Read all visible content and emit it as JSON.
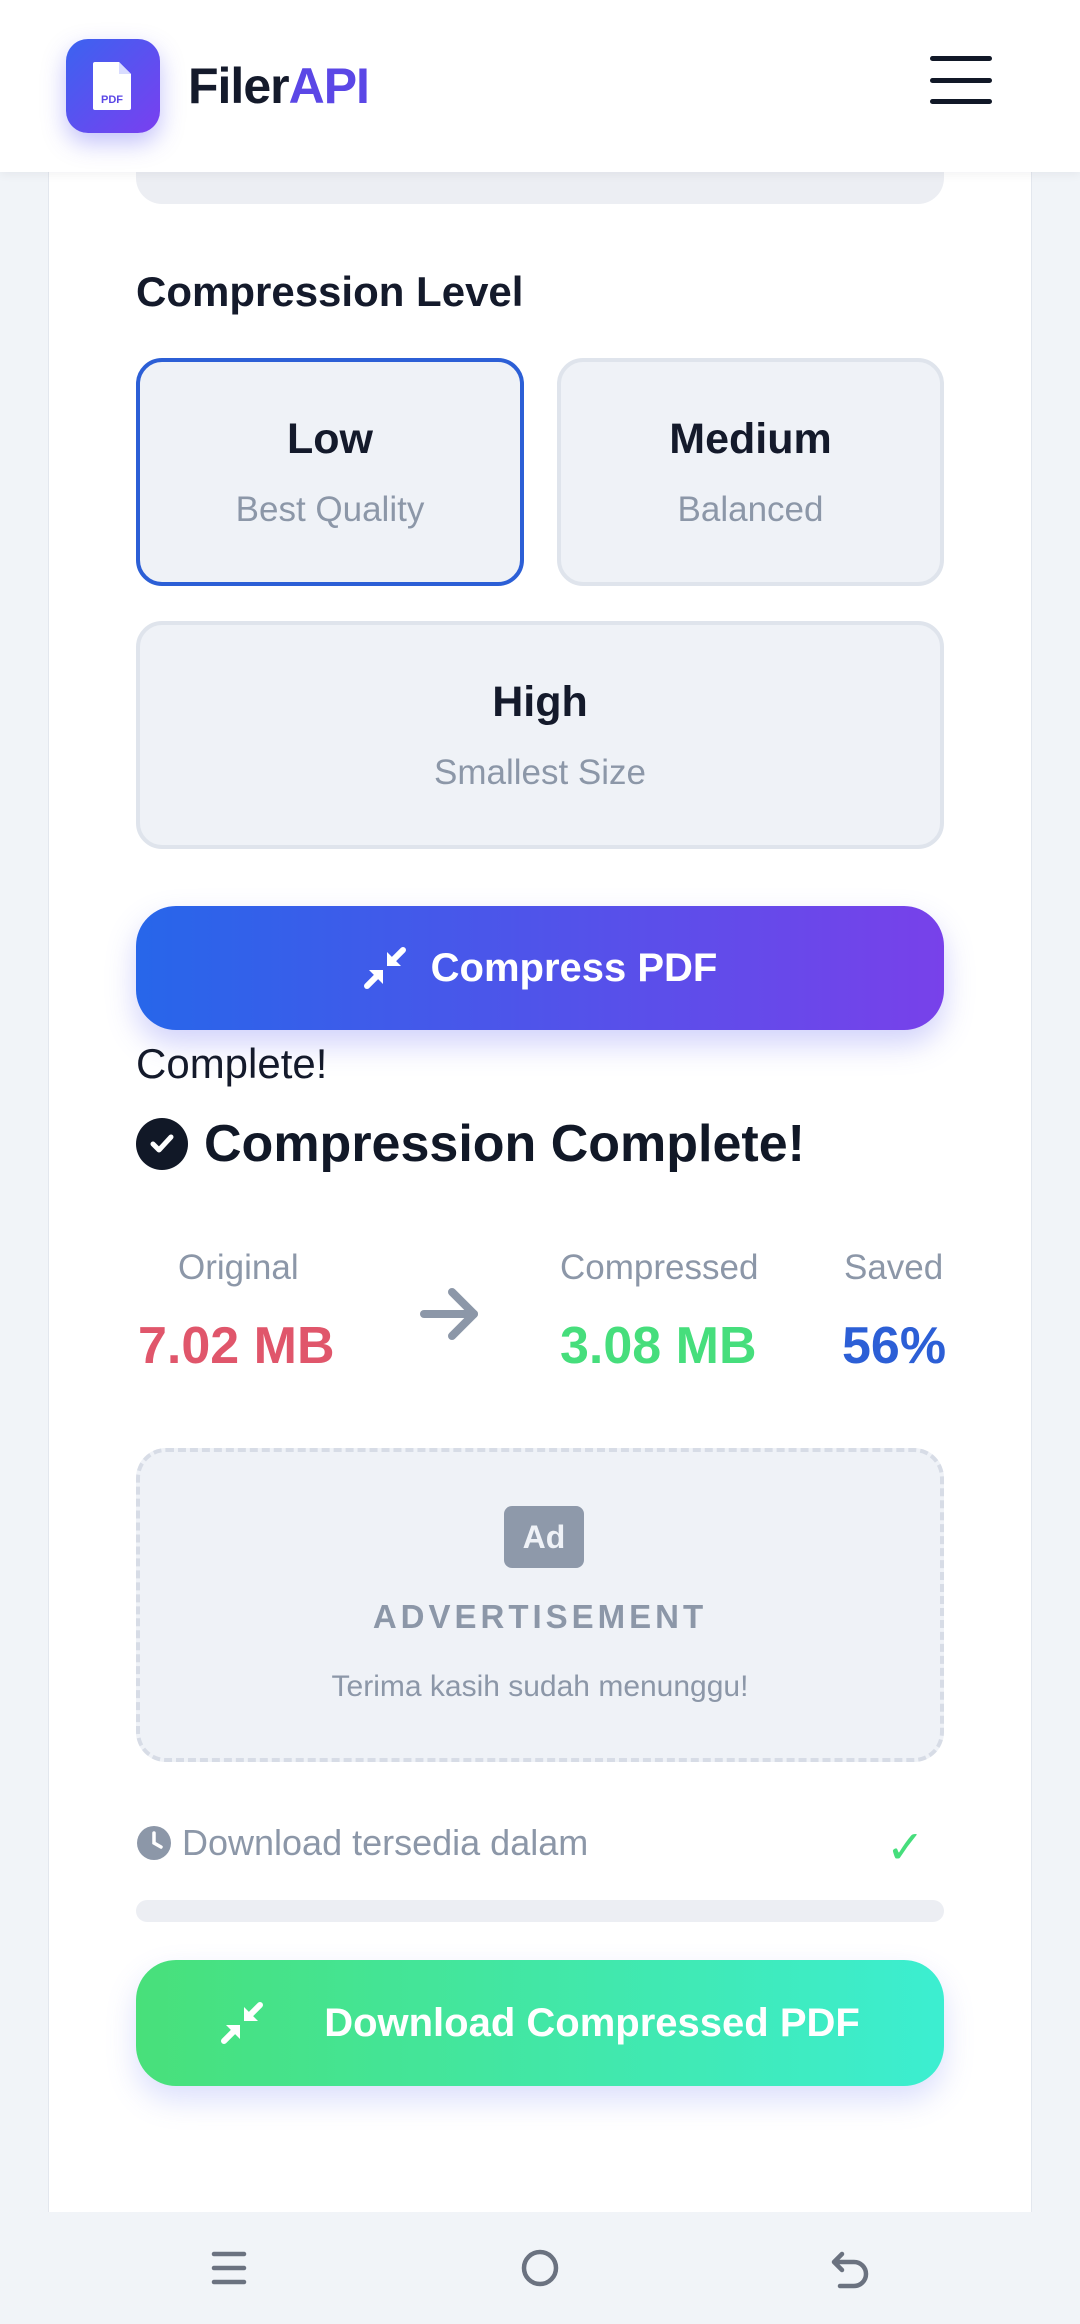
{
  "header": {
    "brand_part1": "Filer",
    "brand_part2": "API",
    "logo_icon": "pdf-file-icon",
    "logo_badge_text": "PDF",
    "menu_icon": "hamburger-menu-icon"
  },
  "compression": {
    "title": "Compression Level",
    "selected": "Low",
    "levels": [
      {
        "name": "Low",
        "subtitle": "Best Quality"
      },
      {
        "name": "Medium",
        "subtitle": "Balanced"
      },
      {
        "name": "High",
        "subtitle": "Smallest Size"
      }
    ],
    "button_label": "Compress PDF",
    "button_icon": "compress-arrows-icon"
  },
  "result": {
    "status_text": "Complete!",
    "heading": "Compression Complete!",
    "original_label": "Original",
    "original_value": "7.02 MB",
    "compressed_label": "Compressed",
    "compressed_value": "3.08 MB",
    "saved_label": "Saved",
    "saved_value": "56%"
  },
  "ad": {
    "icon_text": "Ad",
    "label": "ADVERTISEMENT",
    "subtitle": "Terima kasih sudah menunggu!"
  },
  "download": {
    "wait_text": "Download tersedia dalam",
    "wait_icon": "clock-icon",
    "done_mark": "✓",
    "progress_fraction": 0,
    "button_label": "Download Compressed PDF"
  },
  "colors": {
    "primary": "#2c5fd6",
    "accent_purple": "#7841ea",
    "original_red": "#e0566b",
    "compressed_green": "#46de7c"
  },
  "system_nav": {
    "icons": [
      "recent-apps-icon",
      "home-icon",
      "back-icon"
    ]
  }
}
